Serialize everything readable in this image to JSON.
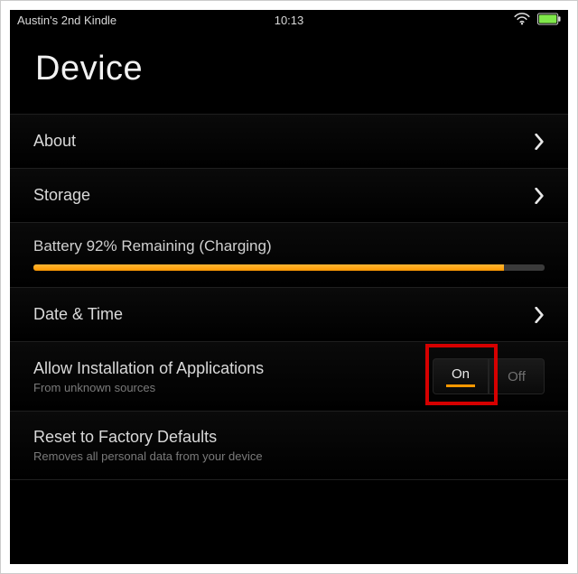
{
  "statusbar": {
    "device_name": "Austin's 2nd Kindle",
    "time": "10:13"
  },
  "page": {
    "title": "Device"
  },
  "rows": {
    "about": {
      "label": "About"
    },
    "storage": {
      "label": "Storage"
    },
    "battery": {
      "label": "Battery 92% Remaining (Charging)",
      "percent": 92
    },
    "datetime": {
      "label": "Date & Time"
    },
    "allow_install": {
      "label": "Allow Installation of Applications",
      "sub": "From unknown sources",
      "on_label": "On",
      "off_label": "Off",
      "value": "On"
    },
    "reset": {
      "label": "Reset to Factory Defaults",
      "sub": "Removes all personal data from your device"
    }
  },
  "colors": {
    "accent": "#ff9800",
    "highlight": "#d60000",
    "battery_icon": "#7fe84a"
  }
}
